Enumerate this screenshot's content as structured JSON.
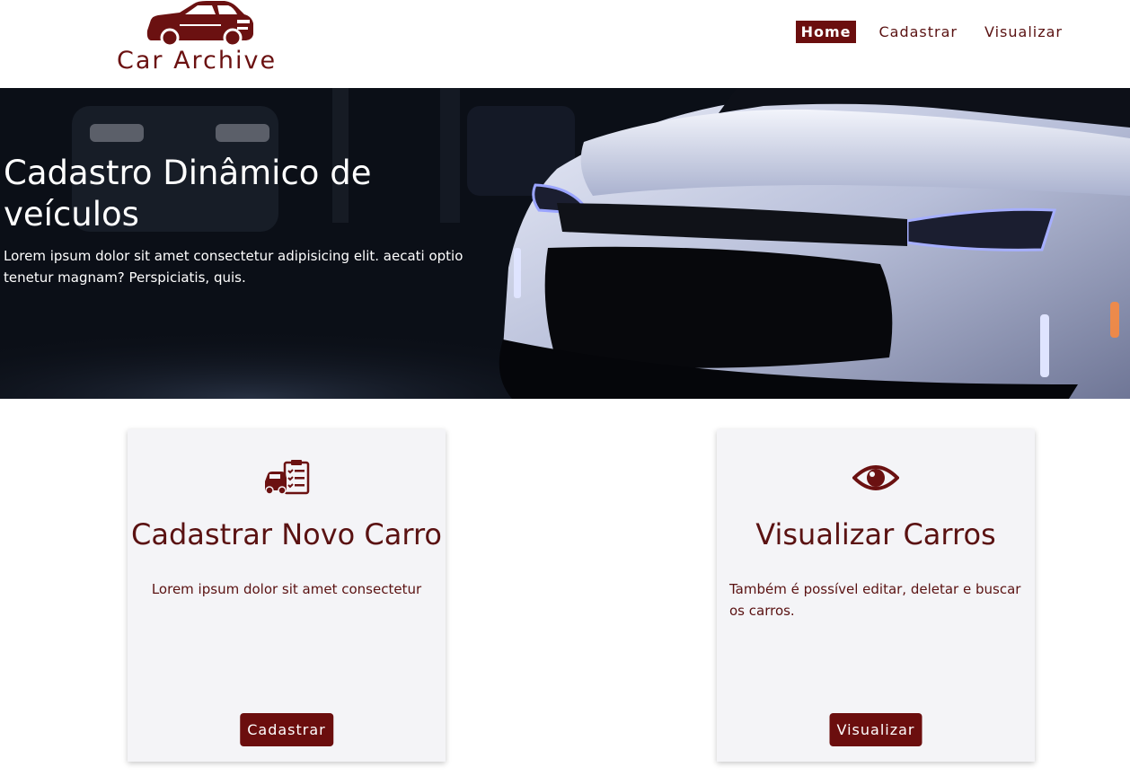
{
  "brand": {
    "name": "Car Archive",
    "logo_icon": "car-logo-icon"
  },
  "nav": {
    "items": [
      {
        "label": "Home",
        "active": true
      },
      {
        "label": "Cadastrar",
        "active": false
      },
      {
        "label": "Visualizar",
        "active": false
      }
    ]
  },
  "hero": {
    "title": "Cadastro Dinâmico de veículos",
    "text": "Lorem ipsum dolor sit amet consectetur adipisicing elit. aecati optio tenetur magnam? Perspiciatis, quis."
  },
  "cards": [
    {
      "icon": "checklist-car-icon",
      "title": "Cadastrar Novo Carro",
      "text": "Lorem ipsum dolor sit amet consectetur",
      "button": "Cadastrar"
    },
    {
      "icon": "eye-icon",
      "title": "Visualizar Carros",
      "text": "Também é possível editar, deletar e buscar os carros.",
      "button": "Visualizar"
    }
  ],
  "colors": {
    "primary": "#6b0e0e",
    "text": "#5a1212",
    "card_bg": "#f4f4f7",
    "hero_bg": "#0d111b"
  }
}
